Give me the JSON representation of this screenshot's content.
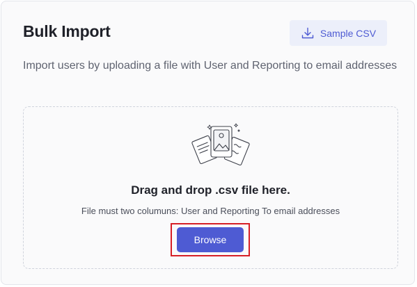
{
  "header": {
    "title": "Bulk Import",
    "sample_button_label": "Sample CSV",
    "sample_button_icon": "download-icon"
  },
  "subtitle": "Import users by uploading a file with User and Reporting to email addresses",
  "dropzone": {
    "illustration_icon": "file-upload-illustration",
    "title": "Drag and drop .csv file here.",
    "description": "File must two columuns: User and Reporting To email addresses",
    "browse_label": "Browse"
  },
  "colors": {
    "accent": "#4e5bd3",
    "sample_button_bg": "#eceffa",
    "highlight": "#d71f26"
  }
}
